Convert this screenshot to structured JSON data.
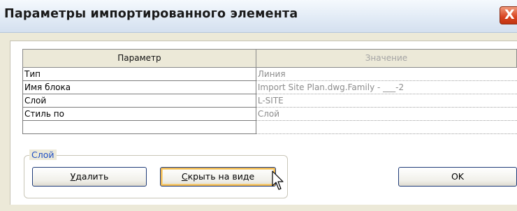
{
  "window": {
    "title": "Параметры импортированного элемента",
    "close_glyph": "X"
  },
  "grid": {
    "headers": {
      "param": "Параметр",
      "value": "Значение"
    },
    "rows": [
      {
        "param": "Тип",
        "value": "Линия"
      },
      {
        "param": "Имя блока",
        "value": "Import Site Plan.dwg.Family - ___-2"
      },
      {
        "param": "Слой",
        "value": "L-SITE"
      },
      {
        "param": "Стиль по",
        "value": "Слой"
      },
      {
        "param": "",
        "value": ""
      }
    ]
  },
  "layer_group": {
    "label": "Слой",
    "delete_button": {
      "mnemonic": "У",
      "rest": "далить"
    },
    "hide_button": {
      "mnemonic": "С",
      "rest": "крыть на виде"
    }
  },
  "ok_button": "OK",
  "colors": {
    "group_label": "#1f4fc4",
    "close_button": "#d8431f",
    "hover_outline": "#f0b953"
  }
}
